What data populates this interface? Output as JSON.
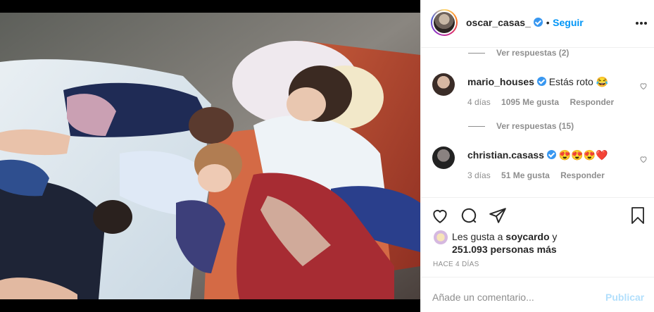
{
  "post": {
    "author": "oscar_casas_",
    "follow_label": "Seguir",
    "separator": "•",
    "more_icon": "more-horizontal-icon",
    "photo_description_icon": "photo"
  },
  "comments": {
    "top_replies": "Ver respuestas (2)",
    "items": [
      {
        "username": "mario_houses",
        "text": "Estás roto 😂",
        "age": "4 días",
        "likes": "1095 Me gusta",
        "reply_label": "Responder",
        "replies": "Ver respuestas (15)"
      },
      {
        "username": "christian.casass",
        "text": "😍😍😍❤️",
        "age": "3 días",
        "likes": "51 Me gusta",
        "reply_label": "Responder"
      }
    ]
  },
  "likes": {
    "prefix": "Les gusta a",
    "user": "soycardo",
    "conj": "y",
    "count": "251.093 personas más"
  },
  "timestamp": "HACE 4 DÍAS",
  "add_comment": {
    "placeholder": "Añade un comentario...",
    "publish_label": "Publicar"
  },
  "colors": {
    "accent": "#0095f6",
    "publish_disabled": "#b2dffc",
    "verified": "#3897f0",
    "muted": "#8e8e8e"
  }
}
